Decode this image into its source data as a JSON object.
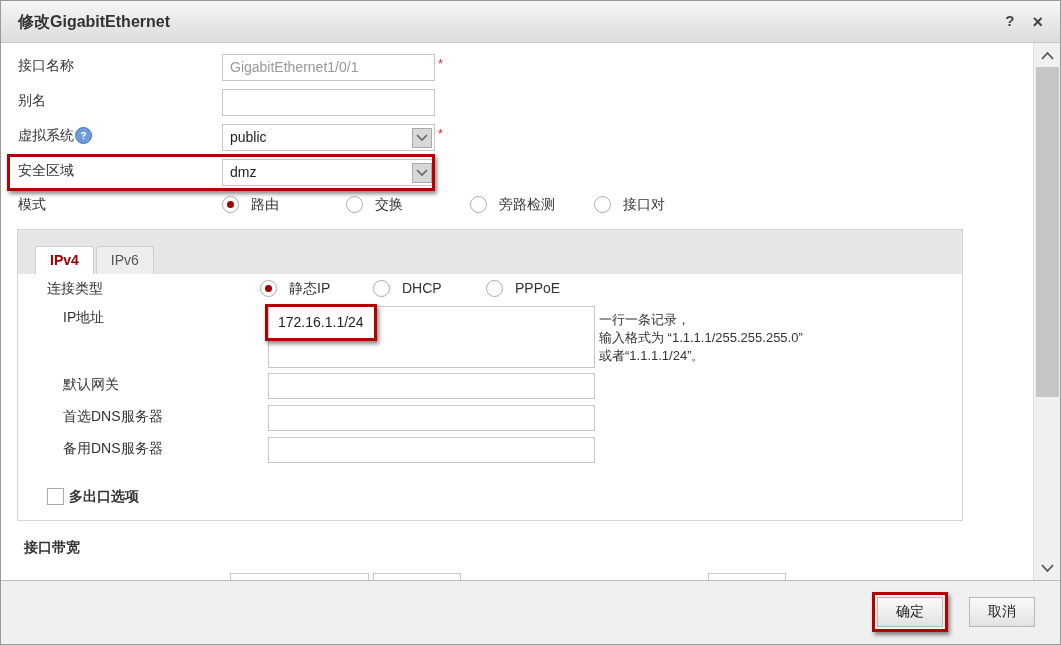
{
  "window": {
    "title": "修改GigabitEthernet",
    "help": "?",
    "close": "×"
  },
  "fields": [
    {
      "kind": "text",
      "label": "接口名称",
      "value": "GigabitEthernet1/0/1",
      "disabled": true,
      "marker": "*"
    },
    {
      "kind": "text",
      "label": "别名"
    },
    {
      "kind": "select",
      "label": "虚拟系统",
      "help": true,
      "value": "public",
      "marker": "*"
    },
    {
      "kind": "select",
      "label": "安全区域",
      "value": "dmz",
      "highlighted": true
    },
    {
      "kind": "radio",
      "label": "模式",
      "options": [
        {
          "label": "路由",
          "selected": true
        },
        {
          "label": "交换",
          "selected": false
        },
        {
          "label": "旁路检测",
          "selected": false
        },
        {
          "label": "接口对",
          "selected": false
        }
      ]
    }
  ],
  "tabs": [
    {
      "label": "IPv4",
      "selected": true
    },
    {
      "label": "IPv6",
      "selected": false
    }
  ],
  "ipv4": {
    "connection": {
      "label": "连接类型",
      "options": [
        {
          "label": "静态IP",
          "selected": true
        },
        {
          "label": "DHCP",
          "selected": false
        },
        {
          "label": "PPPoE",
          "selected": false
        }
      ]
    },
    "ip": {
      "label": "IP地址",
      "value": "172.16.1.1/24",
      "highlighted": true,
      "hint": [
        "一行一条记录，",
        "输入格式为 “1.1.1.1/255.255.255.0”",
        "或者“1.1.1.1/24”。"
      ]
    },
    "inputs": [
      {
        "label": "默认网关"
      },
      {
        "label": "首选DNS服务器"
      },
      {
        "label": "备用DNS服务器"
      }
    ],
    "multi_exit": {
      "label": "多出口选项",
      "checked": false
    }
  },
  "bandwidth": {
    "title": "接口带宽"
  },
  "buttons": [
    {
      "label": "确定",
      "highlighted": true
    },
    {
      "label": "取消",
      "highlighted": false
    }
  ]
}
